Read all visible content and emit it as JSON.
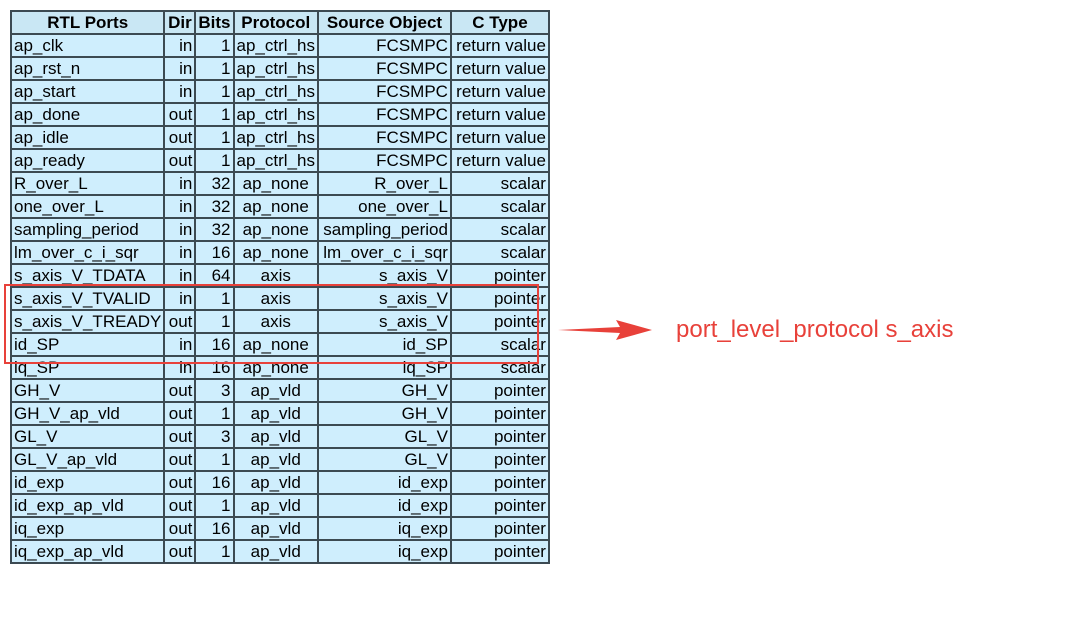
{
  "table": {
    "headers": [
      "RTL Ports",
      "Dir",
      "Bits",
      "Protocol",
      "Source Object",
      "C Type"
    ],
    "rows": [
      [
        "ap_clk",
        "in",
        "1",
        "ap_ctrl_hs",
        "FCSMPC",
        "return value"
      ],
      [
        "ap_rst_n",
        "in",
        "1",
        "ap_ctrl_hs",
        "FCSMPC",
        "return value"
      ],
      [
        "ap_start",
        "in",
        "1",
        "ap_ctrl_hs",
        "FCSMPC",
        "return value"
      ],
      [
        "ap_done",
        "out",
        "1",
        "ap_ctrl_hs",
        "FCSMPC",
        "return value"
      ],
      [
        "ap_idle",
        "out",
        "1",
        "ap_ctrl_hs",
        "FCSMPC",
        "return value"
      ],
      [
        "ap_ready",
        "out",
        "1",
        "ap_ctrl_hs",
        "FCSMPC",
        "return value"
      ],
      [
        "R_over_L",
        "in",
        "32",
        "ap_none",
        "R_over_L",
        "scalar"
      ],
      [
        "one_over_L",
        "in",
        "32",
        "ap_none",
        "one_over_L",
        "scalar"
      ],
      [
        "sampling_period",
        "in",
        "32",
        "ap_none",
        "sampling_period",
        "scalar"
      ],
      [
        "lm_over_c_i_sqr",
        "in",
        "16",
        "ap_none",
        "lm_over_c_i_sqr",
        "scalar"
      ],
      [
        "s_axis_V_TDATA",
        "in",
        "64",
        "axis",
        "s_axis_V",
        "pointer"
      ],
      [
        "s_axis_V_TVALID",
        "in",
        "1",
        "axis",
        "s_axis_V",
        "pointer"
      ],
      [
        "s_axis_V_TREADY",
        "out",
        "1",
        "axis",
        "s_axis_V",
        "pointer"
      ],
      [
        "id_SP",
        "in",
        "16",
        "ap_none",
        "id_SP",
        "scalar"
      ],
      [
        "iq_SP",
        "in",
        "16",
        "ap_none",
        "iq_SP",
        "scalar"
      ],
      [
        "GH_V",
        "out",
        "3",
        "ap_vld",
        "GH_V",
        "pointer"
      ],
      [
        "GH_V_ap_vld",
        "out",
        "1",
        "ap_vld",
        "GH_V",
        "pointer"
      ],
      [
        "GL_V",
        "out",
        "3",
        "ap_vld",
        "GL_V",
        "pointer"
      ],
      [
        "GL_V_ap_vld",
        "out",
        "1",
        "ap_vld",
        "GL_V",
        "pointer"
      ],
      [
        "id_exp",
        "out",
        "16",
        "ap_vld",
        "id_exp",
        "pointer"
      ],
      [
        "id_exp_ap_vld",
        "out",
        "1",
        "ap_vld",
        "id_exp",
        "pointer"
      ],
      [
        "iq_exp",
        "out",
        "16",
        "ap_vld",
        "iq_exp",
        "pointer"
      ],
      [
        "iq_exp_ap_vld",
        "out",
        "1",
        "ap_vld",
        "iq_exp",
        "pointer"
      ]
    ]
  },
  "annotation": {
    "text": "port_level_protocol s_axis",
    "color": "#e8413a",
    "arrow_icon": "right-arrow-icon"
  }
}
